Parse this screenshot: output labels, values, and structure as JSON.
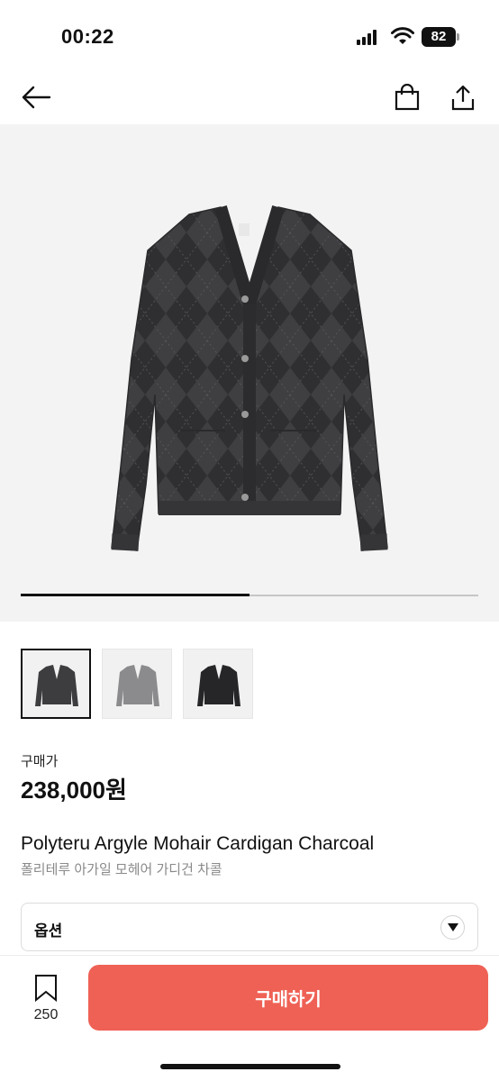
{
  "status": {
    "time": "00:22",
    "battery": "82"
  },
  "nav": {
    "back_icon": "arrow-left-icon",
    "bag_icon": "shopping-bag-icon",
    "share_icon": "share-icon"
  },
  "product": {
    "price_label": "구매가",
    "price": "238,000원",
    "name_en": "Polyteru Argyle Mohair Cardigan Charcoal",
    "name_ko": "폴리테루 아가일 모헤어 가디건 차콜"
  },
  "gallery": {
    "progress": 0.5,
    "thumbnails": [
      "charcoal",
      "grey",
      "black"
    ],
    "selected": 0
  },
  "option": {
    "label": "옵션"
  },
  "bottom": {
    "bookmark_count": "250",
    "buy_label": "구매하기"
  },
  "colors": {
    "accent": "#ef6155"
  }
}
